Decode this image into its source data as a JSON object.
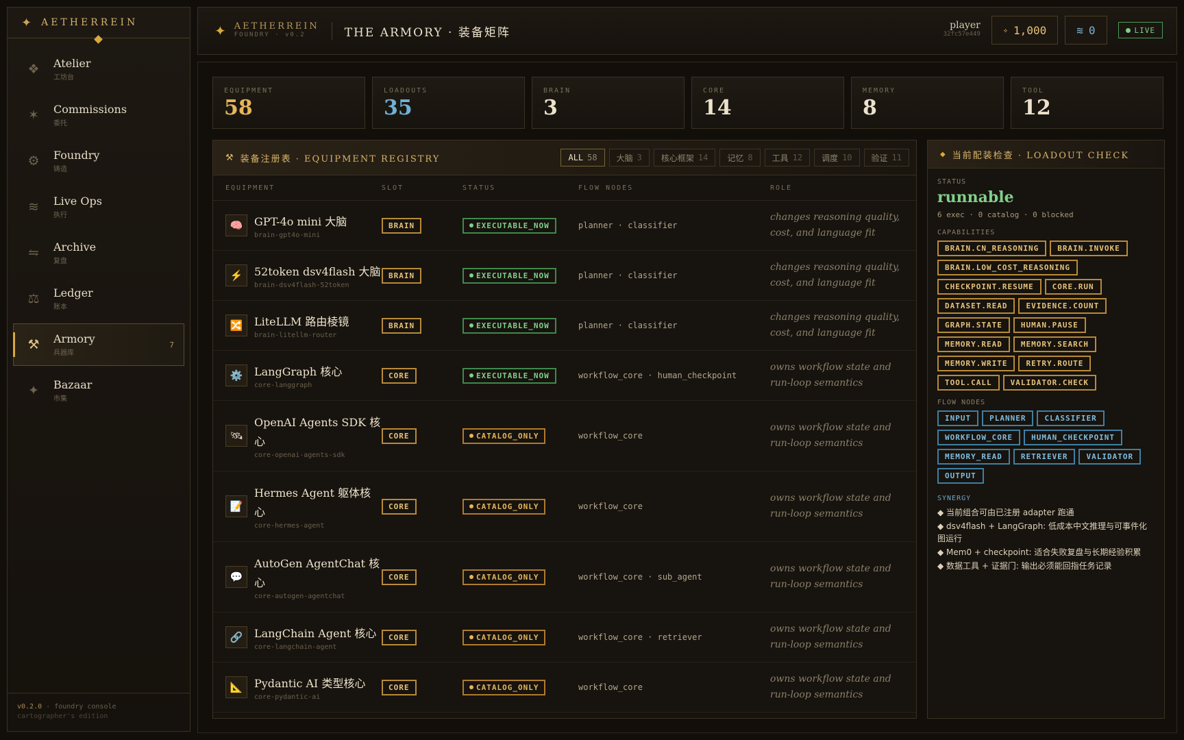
{
  "brand": {
    "name": "AETHERREIN"
  },
  "nav": [
    {
      "label": "Atelier",
      "sub": "工坊台",
      "icon": "❖"
    },
    {
      "label": "Commissions",
      "sub": "委托",
      "icon": "✶"
    },
    {
      "label": "Foundry",
      "sub": "铸造",
      "icon": "⚙"
    },
    {
      "label": "Live Ops",
      "sub": "执行",
      "icon": "≋"
    },
    {
      "label": "Archive",
      "sub": "复盘",
      "icon": "⇋"
    },
    {
      "label": "Ledger",
      "sub": "账本",
      "icon": "⚖"
    },
    {
      "label": "Armory",
      "sub": "兵器库",
      "icon": "⚒",
      "badge": "7"
    },
    {
      "label": "Bazaar",
      "sub": "市集",
      "icon": "✦"
    }
  ],
  "sidebar_footer": {
    "version": "v0.2.0",
    "desc": "· foundry console",
    "edition": "cartographer's edition"
  },
  "header": {
    "brand": "AETHERREIN",
    "brand_sub": "FOUNDRY · v0.2",
    "title": "THE ARMORY · 装备矩阵",
    "user_name": "player",
    "user_hash": "32fc57e449",
    "gold": "1,000",
    "gold_icon": "✧",
    "essence": "0",
    "essence_icon": "≋",
    "live": "LIVE"
  },
  "stats": [
    {
      "key": "EQUIPMENT",
      "value": "58",
      "color": "#e6b45a"
    },
    {
      "key": "LOADOUTS",
      "value": "35",
      "color": "#6fb0d8"
    },
    {
      "key": "BRAIN",
      "value": "3",
      "color": "#ece2cc"
    },
    {
      "key": "CORE",
      "value": "14",
      "color": "#ece2cc"
    },
    {
      "key": "MEMORY",
      "value": "8",
      "color": "#ece2cc"
    },
    {
      "key": "TOOL",
      "value": "12",
      "color": "#ece2cc"
    }
  ],
  "registry": {
    "title": "装备注册表 · EQUIPMENT REGISTRY",
    "tabs": [
      {
        "label": "ALL",
        "count": "58"
      },
      {
        "label": "大脑",
        "count": "3"
      },
      {
        "label": "核心框架",
        "count": "14"
      },
      {
        "label": "记忆",
        "count": "8"
      },
      {
        "label": "工具",
        "count": "12"
      },
      {
        "label": "调度",
        "count": "10"
      },
      {
        "label": "验证",
        "count": "11"
      }
    ],
    "columns": [
      "EQUIPMENT",
      "SLOT",
      "STATUS",
      "FLOW NODES",
      "ROLE"
    ],
    "rows": [
      {
        "icon": "🧠",
        "name": "GPT-4o mini 大脑",
        "id": "brain-gpt4o-mini",
        "slot": "BRAIN",
        "status": "EXECUTABLE_NOW",
        "flow": "planner · classifier",
        "role": "changes reasoning quality, cost, and language fit"
      },
      {
        "icon": "⚡",
        "name": "52token dsv4flash 大脑",
        "id": "brain-dsv4flash-52token",
        "slot": "BRAIN",
        "status": "EXECUTABLE_NOW",
        "flow": "planner · classifier",
        "role": "changes reasoning quality, cost, and language fit"
      },
      {
        "icon": "🔀",
        "name": "LiteLLM 路由棱镜",
        "id": "brain-litellm-router",
        "slot": "BRAIN",
        "status": "EXECUTABLE_NOW",
        "flow": "planner · classifier",
        "role": "changes reasoning quality, cost, and language fit"
      },
      {
        "icon": "⚙️",
        "name": "LangGraph 核心",
        "id": "core-langgraph",
        "slot": "CORE",
        "status": "EXECUTABLE_NOW",
        "flow": "workflow_core · human_checkpoint",
        "role": "owns workflow state and run-loop semantics"
      },
      {
        "icon": "🛰",
        "name": "OpenAI Agents SDK 核心",
        "id": "core-openai-agents-sdk",
        "slot": "CORE",
        "status": "CATALOG_ONLY",
        "flow": "workflow_core",
        "role": "owns workflow state and run-loop semantics"
      },
      {
        "icon": "📝",
        "name": "Hermes Agent 躯体核心",
        "id": "core-hermes-agent",
        "slot": "CORE",
        "status": "CATALOG_ONLY",
        "flow": "workflow_core",
        "role": "owns workflow state and run-loop semantics"
      },
      {
        "icon": "💬",
        "name": "AutoGen AgentChat 核心",
        "id": "core-autogen-agentchat",
        "slot": "CORE",
        "status": "CATALOG_ONLY",
        "flow": "workflow_core · sub_agent",
        "role": "owns workflow state and run-loop semantics"
      },
      {
        "icon": "🔗",
        "name": "LangChain Agent 核心",
        "id": "core-langchain-agent",
        "slot": "CORE",
        "status": "CATALOG_ONLY",
        "flow": "workflow_core · retriever",
        "role": "owns workflow state and run-loop semantics"
      },
      {
        "icon": "📐",
        "name": "Pydantic AI 类型核心",
        "id": "core-pydantic-ai",
        "slot": "CORE",
        "status": "CATALOG_ONLY",
        "flow": "workflow_core",
        "role": "owns workflow state and run-loop semantics"
      }
    ]
  },
  "loadout": {
    "title": "当前配装检查 · LOADOUT CHECK",
    "status_label": "STATUS",
    "status": "runnable",
    "counts": "6 exec · 0 catalog · 0 blocked",
    "capabilities_label": "CAPABILITIES",
    "capabilities": [
      "BRAIN.CN_REASONING",
      "BRAIN.INVOKE",
      "BRAIN.LOW_COST_REASONING",
      "CHECKPOINT.RESUME",
      "CORE.RUN",
      "DATASET.READ",
      "EVIDENCE.COUNT",
      "GRAPH.STATE",
      "HUMAN.PAUSE",
      "MEMORY.READ",
      "MEMORY.SEARCH",
      "MEMORY.WRITE",
      "RETRY.ROUTE",
      "TOOL.CALL",
      "VALIDATOR.CHECK"
    ],
    "flow_label": "FLOW NODES",
    "flow_nodes": [
      "INPUT",
      "PLANNER",
      "CLASSIFIER",
      "WORKFLOW_CORE",
      "HUMAN_CHECKPOINT",
      "MEMORY_READ",
      "RETRIEVER",
      "VALIDATOR",
      "OUTPUT"
    ],
    "synergy_label": "SYNERGY",
    "synergy": [
      "◆ 当前组合可由已注册 adapter 跑通",
      "◆ dsv4flash + LangGraph: 低成本中文推理与可事件化图运行",
      "◆ Mem0 + checkpoint: 适合失败复盘与长期经验积累",
      "◆ 数据工具 + 证据门: 输出必须能回指任务记录"
    ]
  }
}
